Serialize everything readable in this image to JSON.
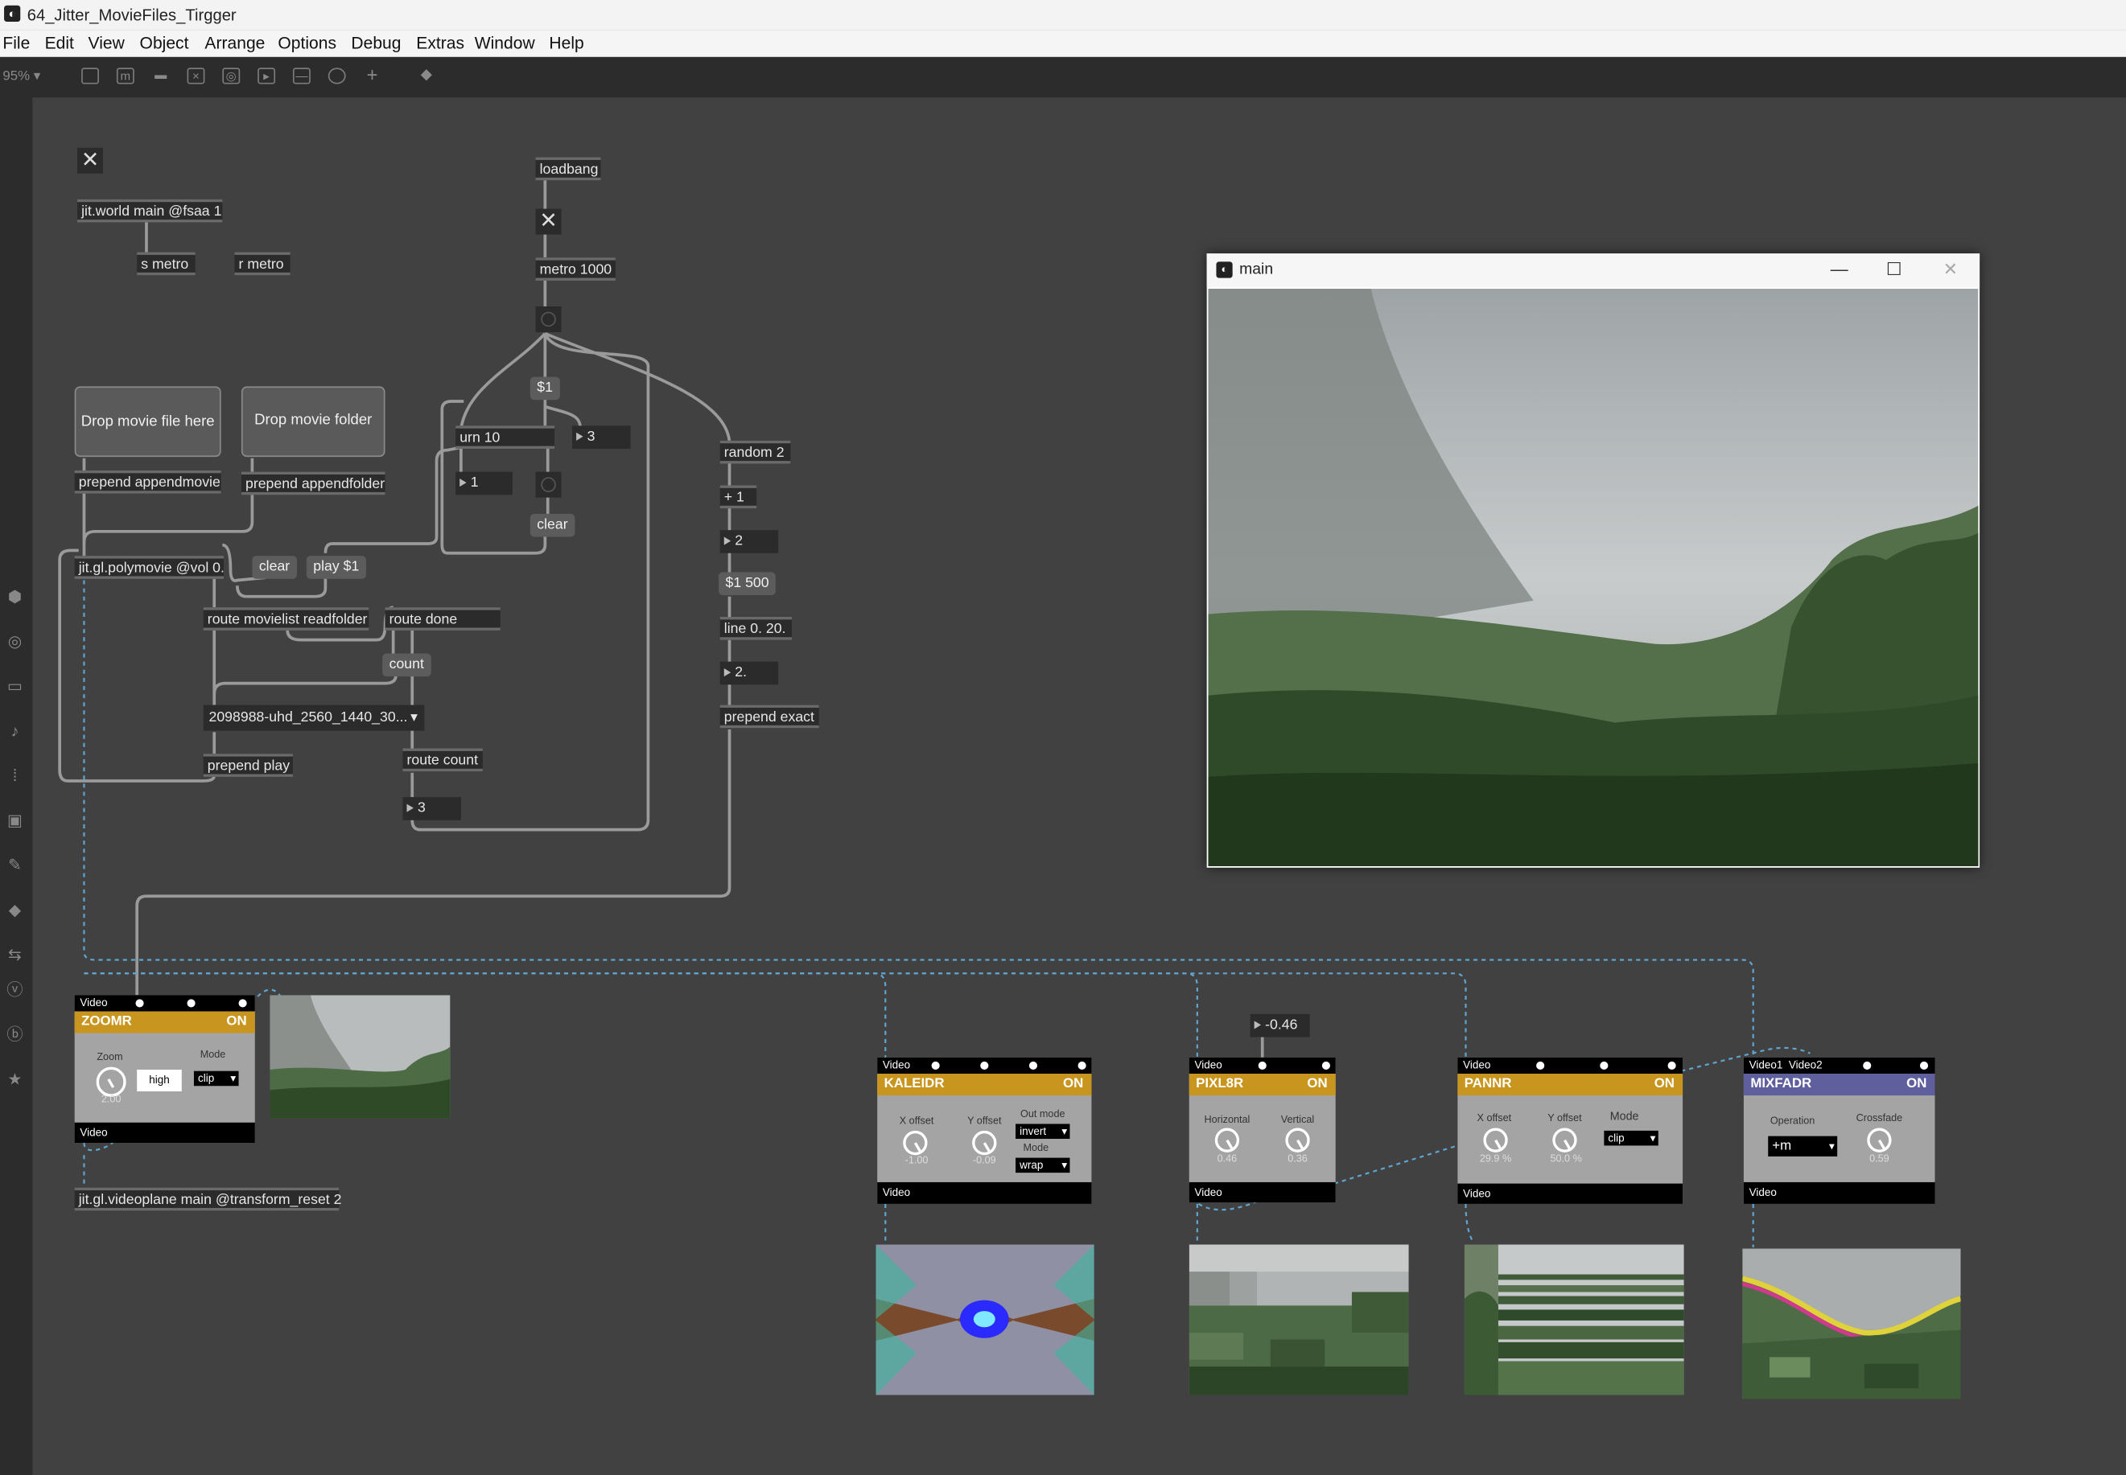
{
  "window_title": "64_Jitter_MovieFiles_Tirgger",
  "menu": [
    "File",
    "Edit",
    "View",
    "Object",
    "Arrange",
    "Options",
    "Debug",
    "Extras",
    "Window",
    "Help"
  ],
  "toolbar": {
    "zoom": "95% ▾"
  },
  "patch": {
    "jit_world": "jit.world main @fsaa 1",
    "s_metro": "s metro",
    "r_metro": "r metro",
    "loadbang": "loadbang",
    "metro": "metro 1000",
    "dollar1": "$1",
    "urn": "urn 10",
    "num_urn_right": "3",
    "num_urn_left": "1",
    "clear_urn": "clear",
    "random": "random 2",
    "plus1": "+ 1",
    "num_rand": "2",
    "dollar1_500": "$1 500",
    "line": "line 0. 20.",
    "num_line": "2.",
    "prepend_exact": "prepend exact",
    "drop_file": "Drop movie file here",
    "drop_folder": "Drop movie folder",
    "prepend_appendmovie": "prepend appendmovie",
    "prepend_appendfolder": "prepend appendfolder",
    "polymovie": "jit.gl.polymovie @vol 0.",
    "clear_msg": "clear",
    "play_msg": "play $1",
    "route_movielist": "route movielist readfolder",
    "route_done": "route done",
    "count_msg": "count",
    "umenu": "2098988-uhd_2560_1440_30...",
    "prepend_play": "prepend play",
    "route_count": "route count",
    "num_count": "3",
    "num_pixl8r": "-0.46",
    "videoplane": "jit.gl.videoplane main @transform_reset 2"
  },
  "main_window": {
    "title": "main"
  },
  "vizzies": {
    "zoomr": {
      "top": "Video",
      "name": "ZOOMR",
      "on": "ON",
      "zoom_label": "Zoom",
      "zoom_val": "2.00",
      "quality": "high",
      "mode_label": "Mode",
      "mode": "clip",
      "bottom": "Video",
      "color": "#c8961f"
    },
    "kaleidr": {
      "top": "Video",
      "name": "KALEIDR",
      "on": "ON",
      "x_label": "X offset",
      "x_val": "-1.00",
      "y_label": "Y offset",
      "y_val": "-0.09",
      "out_label": "Out mode",
      "out_val": "invert",
      "mode_label": "Mode",
      "mode_val": "wrap",
      "bottom": "Video",
      "color": "#c8961f"
    },
    "pixl8r": {
      "top": "Video",
      "name": "PIXL8R",
      "on": "ON",
      "h_label": "Horizontal",
      "h_val": "0.46",
      "v_label": "Vertical",
      "v_val": "0.36",
      "bottom": "Video",
      "color": "#c8961f"
    },
    "pannr": {
      "top": "Video",
      "name": "PANNR",
      "on": "ON",
      "x_label": "X offset",
      "x_val": "29.9 %",
      "y_label": "Y offset",
      "y_val": "50.0 %",
      "mode_label": "Mode",
      "mode_val": "clip",
      "bottom": "Video",
      "color": "#c8961f"
    },
    "mixfadr": {
      "top1": "Video1",
      "top2": "Video2",
      "name": "MIXFADR",
      "on": "ON",
      "op_label": "Operation",
      "op_val": "+m",
      "cf_label": "Crossfade",
      "cf_val": "0.59",
      "bottom": "Video",
      "color": "#5f5f9e"
    }
  }
}
